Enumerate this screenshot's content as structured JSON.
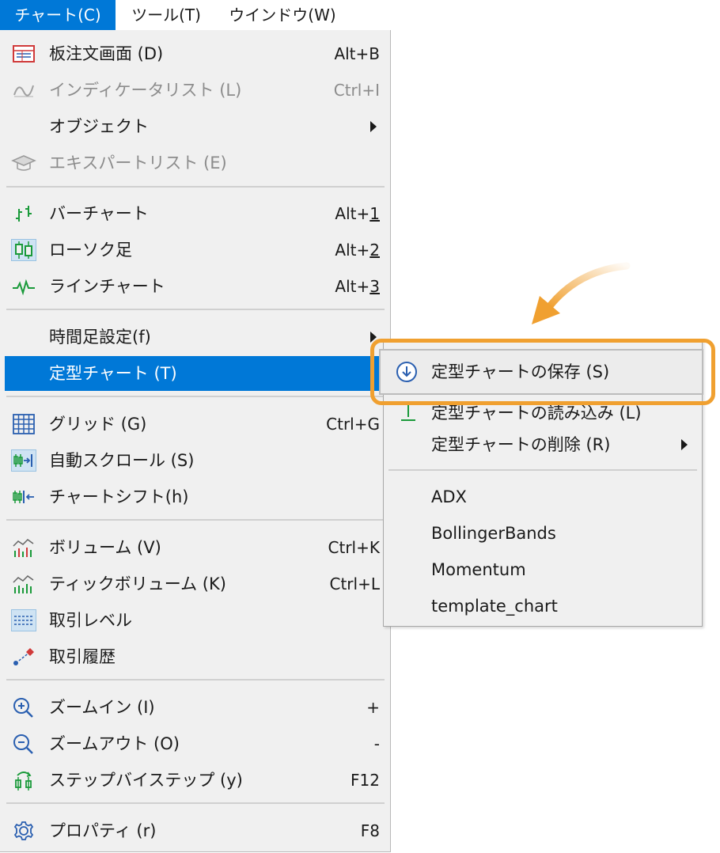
{
  "menubar": {
    "items": [
      {
        "label": "チャート(C)",
        "active": true
      },
      {
        "label": "ツール(T)",
        "active": false
      },
      {
        "label": "ウインドウ(W)",
        "active": false
      }
    ]
  },
  "menu": {
    "items": [
      {
        "label": "板注文画面 (D)",
        "shortcut": "Alt+B",
        "icon": "order-book-icon"
      },
      {
        "label": "インディケータリスト (L)",
        "shortcut": "Ctrl+I",
        "icon": "indicator-icon",
        "disabled": true
      },
      {
        "label": "オブジェクト",
        "submenu": true
      },
      {
        "label": "エキスパートリスト (E)",
        "icon": "expert-hat-icon",
        "disabled": true
      },
      {
        "label": "バーチャート",
        "shortcut_prefix": "Alt+",
        "shortcut_key": "1",
        "icon": "bar-chart-icon"
      },
      {
        "label": "ローソク足",
        "shortcut_prefix": "Alt+",
        "shortcut_key": "2",
        "icon": "candlestick-icon"
      },
      {
        "label": "ラインチャート",
        "shortcut_prefix": "Alt+",
        "shortcut_key": "3",
        "icon": "line-chart-icon"
      },
      {
        "label": "時間足設定(f)",
        "submenu": true
      },
      {
        "label": "定型チャート (T)",
        "submenu": true,
        "highlighted": true
      },
      {
        "label": "グリッド (G)",
        "shortcut": "Ctrl+G",
        "icon": "grid-icon"
      },
      {
        "label": "自動スクロール (S)",
        "icon": "auto-scroll-icon"
      },
      {
        "label": "チャートシフト(h)",
        "icon": "chart-shift-icon"
      },
      {
        "label": "ボリューム (V)",
        "shortcut": "Ctrl+K",
        "icon": "volume-icon"
      },
      {
        "label": "ティックボリューム (K)",
        "shortcut": "Ctrl+L",
        "icon": "tick-volume-icon"
      },
      {
        "label": "取引レベル",
        "icon": "trade-levels-icon"
      },
      {
        "label": "取引履歴",
        "icon": "trade-history-icon"
      },
      {
        "label": "ズームイン (I)",
        "shortcut": "+",
        "icon": "zoom-in-icon"
      },
      {
        "label": "ズームアウト (O)",
        "shortcut": "-",
        "icon": "zoom-out-icon"
      },
      {
        "label": "ステップバイステップ (y)",
        "shortcut": "F12",
        "icon": "step-icon"
      },
      {
        "label": "プロパティ (r)",
        "shortcut": "F8",
        "icon": "gear-icon"
      }
    ]
  },
  "submenu": {
    "items": [
      {
        "label": "定型チャートの保存 (S)",
        "icon": "save-template-icon",
        "callout": true
      },
      {
        "label": "定型チャートの読み込み (L)",
        "icon": "load-template-icon"
      },
      {
        "label": "定型チャートの削除 (R)",
        "submenu": true
      },
      {
        "label": "ADX"
      },
      {
        "label": "BollingerBands"
      },
      {
        "label": "Momentum"
      },
      {
        "label": "template_chart"
      }
    ]
  },
  "colors": {
    "accent": "#0078d7",
    "callout": "#f0a030"
  }
}
